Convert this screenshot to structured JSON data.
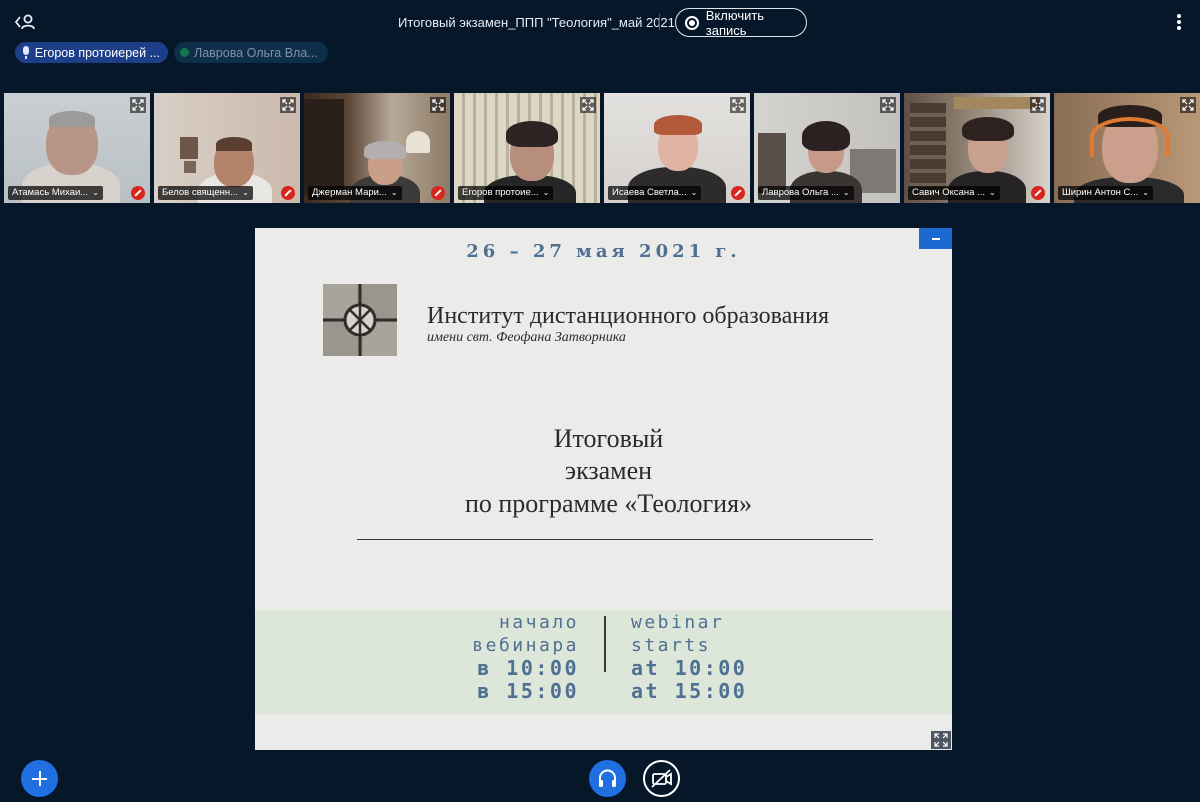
{
  "topbar": {
    "room_title": "Итоговый экзамен_ППП \"Теология\"_май 2021",
    "record_button_label": "Включить запись"
  },
  "talkers": {
    "active": "Егоров протоиерей ...",
    "inactive": "Лаврова Ольга Вла..."
  },
  "participants": [
    {
      "name": "Атамась Михаи...",
      "muted": true
    },
    {
      "name": "Белов священн...",
      "muted": true
    },
    {
      "name": "Джерман Мари...",
      "muted": true
    },
    {
      "name": "Егоров протоие...",
      "muted": false
    },
    {
      "name": "Исаева Светла...",
      "muted": true
    },
    {
      "name": "Лаврова Ольга ...",
      "muted": false
    },
    {
      "name": "Савич Оксана ...",
      "muted": true
    },
    {
      "name": "Ширин Антон С...",
      "muted": false
    }
  ],
  "slide": {
    "date": "26 – 27 мая 2021 г.",
    "institute_title": "Институт дистанционного образования",
    "institute_subtitle": "имени свт. Феофана Затворника",
    "exam_line1": "Итоговый",
    "exam_line2": "экзамен",
    "exam_line3": "по программе «Теология»",
    "left_line1": "начало",
    "left_line2": "вебинара",
    "left_line3": "в 10:00",
    "left_line4": "в 15:00",
    "right_line1": "webinar",
    "right_line2": "starts",
    "right_line3": "at 10:00",
    "right_line4": "at 15:00"
  },
  "icons": {
    "users": "users-toggle-icon",
    "options": "kebab-menu-icon",
    "actions": "plus-icon",
    "audio": "headphones-icon",
    "video": "video-off-icon"
  },
  "colors": {
    "background": "#06172a",
    "accent": "#1f6fe0",
    "slide_text_blue": "#4f6f93",
    "muted_red": "#d8251d"
  }
}
